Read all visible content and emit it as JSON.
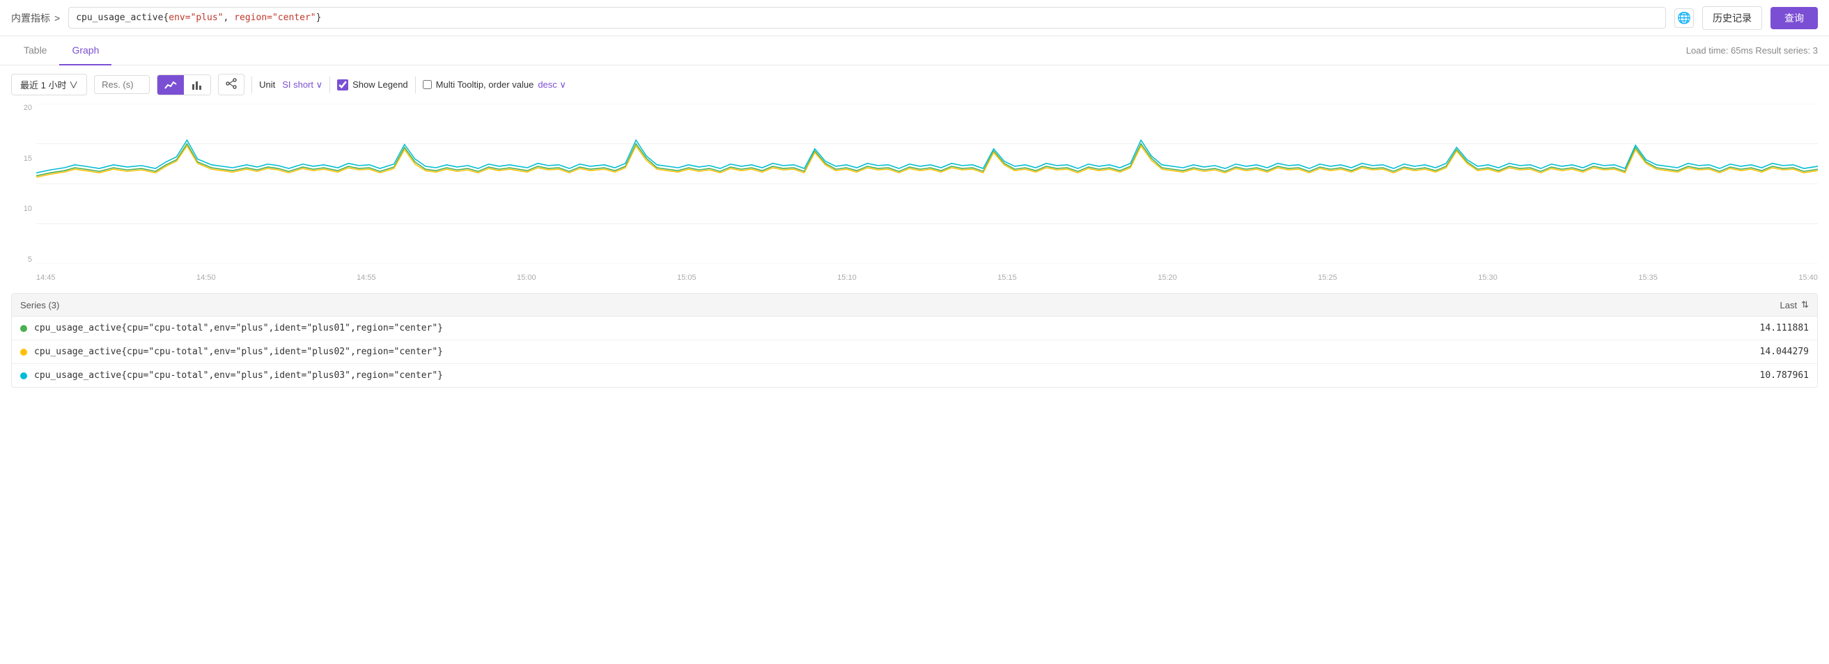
{
  "topbar": {
    "breadcrumb": "内置指标",
    "breadcrumb_sep": ">",
    "query": "cpu_usage_active{env=\"plus\", region=\"center\"}",
    "query_display": "cpu_usage_active{",
    "query_env_key": "env",
    "query_env_val": "\"plus\"",
    "query_region_key": "region",
    "query_region_val": "\"center\"",
    "btn_history": "历史记录",
    "btn_query": "查询",
    "globe_icon": "🌐"
  },
  "tabs": {
    "table": "Table",
    "graph": "Graph",
    "meta": "Load time: 65ms    Result series: 3"
  },
  "controls": {
    "time_range": "最近 1 小时 ∨",
    "resolution_placeholder": "Res. (s)",
    "unit_label": "Unit",
    "unit_value": "SI short ∨",
    "show_legend_label": "Show Legend",
    "tooltip_label": "Multi Tooltip, order value",
    "order_value": "desc ∨"
  },
  "chart": {
    "y_labels": [
      "20",
      "15",
      "10",
      "5"
    ],
    "x_labels": [
      "14:45",
      "14:50",
      "14:55",
      "15:00",
      "15:05",
      "15:10",
      "15:15",
      "15:20",
      "15:25",
      "15:30",
      "15:35",
      "15:40"
    ],
    "grid_y_positions": [
      0,
      25,
      50,
      75,
      100
    ]
  },
  "series": {
    "header": "Series (3)",
    "last_col": "Last",
    "rows": [
      {
        "color": "#4caf50",
        "name": "cpu_usage_active{cpu=\"cpu-total\",env=\"plus\",ident=\"plus01\",region=\"center\"}",
        "value": "14.111881"
      },
      {
        "color": "#ffc107",
        "name": "cpu_usage_active{cpu=\"cpu-total\",env=\"plus\",ident=\"plus02\",region=\"center\"}",
        "value": "14.044279"
      },
      {
        "color": "#00bcd4",
        "name": "cpu_usage_active{cpu=\"cpu-total\",env=\"plus\",ident=\"plus03\",region=\"center\"}",
        "value": "10.787961"
      }
    ]
  }
}
